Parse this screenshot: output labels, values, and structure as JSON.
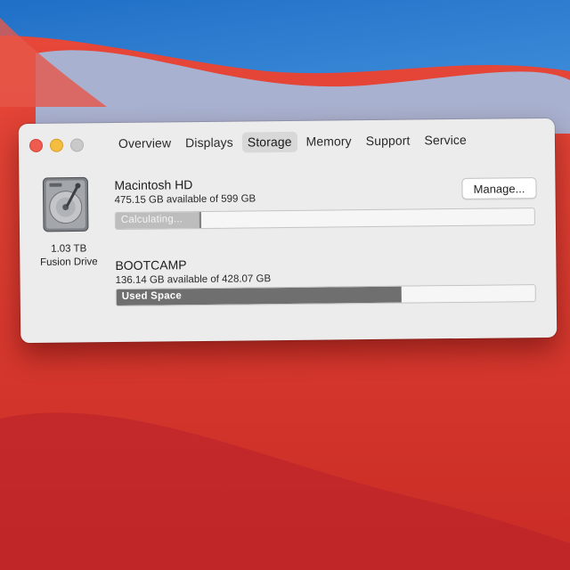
{
  "colors": {
    "wallpaper_red": "#d9392b",
    "wallpaper_blue": "#2f7fd0",
    "window_bg": "#ececec",
    "used_space_fill": "#6f6f6f"
  },
  "window": {
    "tabs": [
      {
        "label": "Overview",
        "active": false
      },
      {
        "label": "Displays",
        "active": false
      },
      {
        "label": "Storage",
        "active": true
      },
      {
        "label": "Memory",
        "active": false
      },
      {
        "label": "Support",
        "active": false
      },
      {
        "label": "Service",
        "active": false
      }
    ]
  },
  "storage": {
    "disk": {
      "icon": "hard-drive-icon",
      "size": "1.03 TB",
      "type": "Fusion Drive"
    },
    "manage_label": "Manage...",
    "volumes": [
      {
        "name": "Macintosh HD",
        "available": "475.15 GB available of 599 GB",
        "bar_label": "Calculating...",
        "fill_fraction": 0.2
      },
      {
        "name": "BOOTCAMP",
        "available": "136.14 GB available of 428.07 GB",
        "bar_label": "Used Space",
        "fill_fraction": 0.68
      }
    ]
  }
}
